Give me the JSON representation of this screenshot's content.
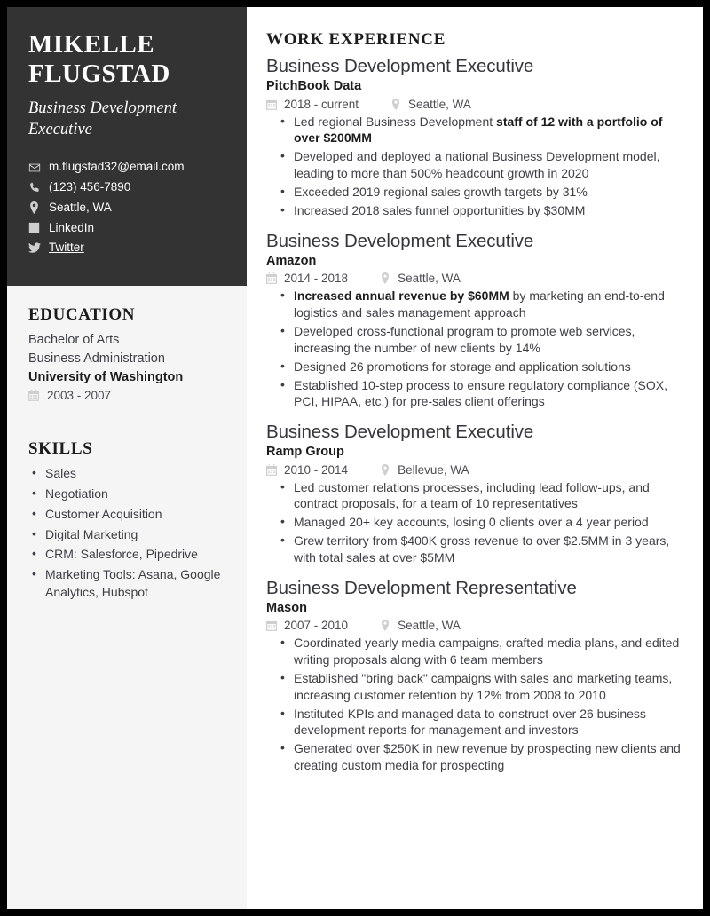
{
  "sidebar": {
    "name": "MIKELLE FLUGSTAD",
    "name_line1": "MIKELLE",
    "name_line2": "FLUGSTAD",
    "subtitle": "Business Development Executive",
    "contacts": [
      {
        "icon": "envelope-icon",
        "label": "m.flugstad32@email.com",
        "link": false
      },
      {
        "icon": "phone-icon",
        "label": "(123) 456-7890",
        "link": false
      },
      {
        "icon": "map-pin-icon",
        "label": "Seattle, WA",
        "link": false
      },
      {
        "icon": "linkedin-icon",
        "label": "LinkedIn",
        "link": true
      },
      {
        "icon": "twitter-icon",
        "label": "Twitter",
        "link": true
      }
    ],
    "education": {
      "heading": "EDUCATION",
      "degree": "Bachelor of Arts",
      "field": "Business Administration",
      "school": "University of Washington",
      "date_icon": "calendar-icon",
      "dates": "2003 - 2007"
    },
    "skills": {
      "heading": "SKILLS",
      "items": [
        "Sales",
        "Negotiation",
        "Customer Acquisition",
        "Digital Marketing",
        "CRM: Salesforce, Pipedrive",
        "Marketing Tools: Asana, Google Analytics, Hubspot"
      ]
    }
  },
  "main": {
    "heading": "WORK EXPERIENCE",
    "jobs": [
      {
        "title": "Business Development Executive",
        "company": "PitchBook Data",
        "dates": "2018 - current",
        "location": "Seattle, WA",
        "bullets": [
          {
            "pre": "Led regional Business Development ",
            "bold": "staff of 12 with a portfolio of over $200MM",
            "post": ""
          },
          {
            "pre": "Developed and deployed a national Business Development model, leading to more than 500% headcount growth in 2020",
            "bold": "",
            "post": ""
          },
          {
            "pre": "Exceeded 2019 regional sales growth targets by 31%",
            "bold": "",
            "post": ""
          },
          {
            "pre": "Increased 2018 sales funnel opportunities by $30MM",
            "bold": "",
            "post": ""
          }
        ]
      },
      {
        "title": "Business Development Executive",
        "company": "Amazon",
        "dates": "2014 - 2018",
        "location": "Seattle, WA",
        "bullets": [
          {
            "pre": "",
            "bold": "Increased annual revenue by $60MM",
            "post": " by marketing an end-to-end logistics and sales management approach"
          },
          {
            "pre": "Developed cross-functional program to promote web services, increasing the number of new clients by 14%",
            "bold": "",
            "post": ""
          },
          {
            "pre": "Designed 26 promotions for storage and application solutions",
            "bold": "",
            "post": ""
          },
          {
            "pre": "Established 10-step process to ensure regulatory compliance (SOX, PCI, HIPAA, etc.) for pre-sales client offerings",
            "bold": "",
            "post": ""
          }
        ]
      },
      {
        "title": "Business Development Executive",
        "company": "Ramp Group",
        "dates": "2010 - 2014",
        "location": "Bellevue, WA",
        "bullets": [
          {
            "pre": "Led customer relations processes, including lead follow-ups, and contract proposals, for a team of 10 representatives",
            "bold": "",
            "post": ""
          },
          {
            "pre": "Managed 20+ key accounts, losing 0 clients over a 4 year period",
            "bold": "",
            "post": ""
          },
          {
            "pre": "Grew territory from $400K gross revenue to over $2.5MM in 3 years, with total sales at over $5MM",
            "bold": "",
            "post": ""
          }
        ]
      },
      {
        "title": "Business Development Representative",
        "company": "Mason",
        "dates": "2007 - 2010",
        "location": "Seattle, WA",
        "bullets": [
          {
            "pre": "Coordinated yearly media campaigns, crafted media plans, and edited writing proposals along with 6 team members",
            "bold": "",
            "post": ""
          },
          {
            "pre": "Established \"bring back\" campaigns with sales and marketing teams, increasing customer retention by 12% from 2008 to 2010",
            "bold": "",
            "post": ""
          },
          {
            "pre": "Instituted KPIs and managed data to construct over 26 business development reports for management and investors",
            "bold": "",
            "post": ""
          },
          {
            "pre": "Generated over $250K in new revenue by prospecting new clients and creating custom media for prospecting",
            "bold": "",
            "post": ""
          }
        ]
      }
    ],
    "icons": {
      "date": "calendar-icon",
      "location": "map-pin-icon"
    }
  },
  "colors": {
    "page_border": "#000000",
    "header_block": "#333333",
    "sidebar_bg": "#f5f5f6",
    "main_bg": "#ffffff",
    "heading_text": "#1c1c1c",
    "body_text": "#3c3f44",
    "icon_gray": "#cfcfcf"
  }
}
